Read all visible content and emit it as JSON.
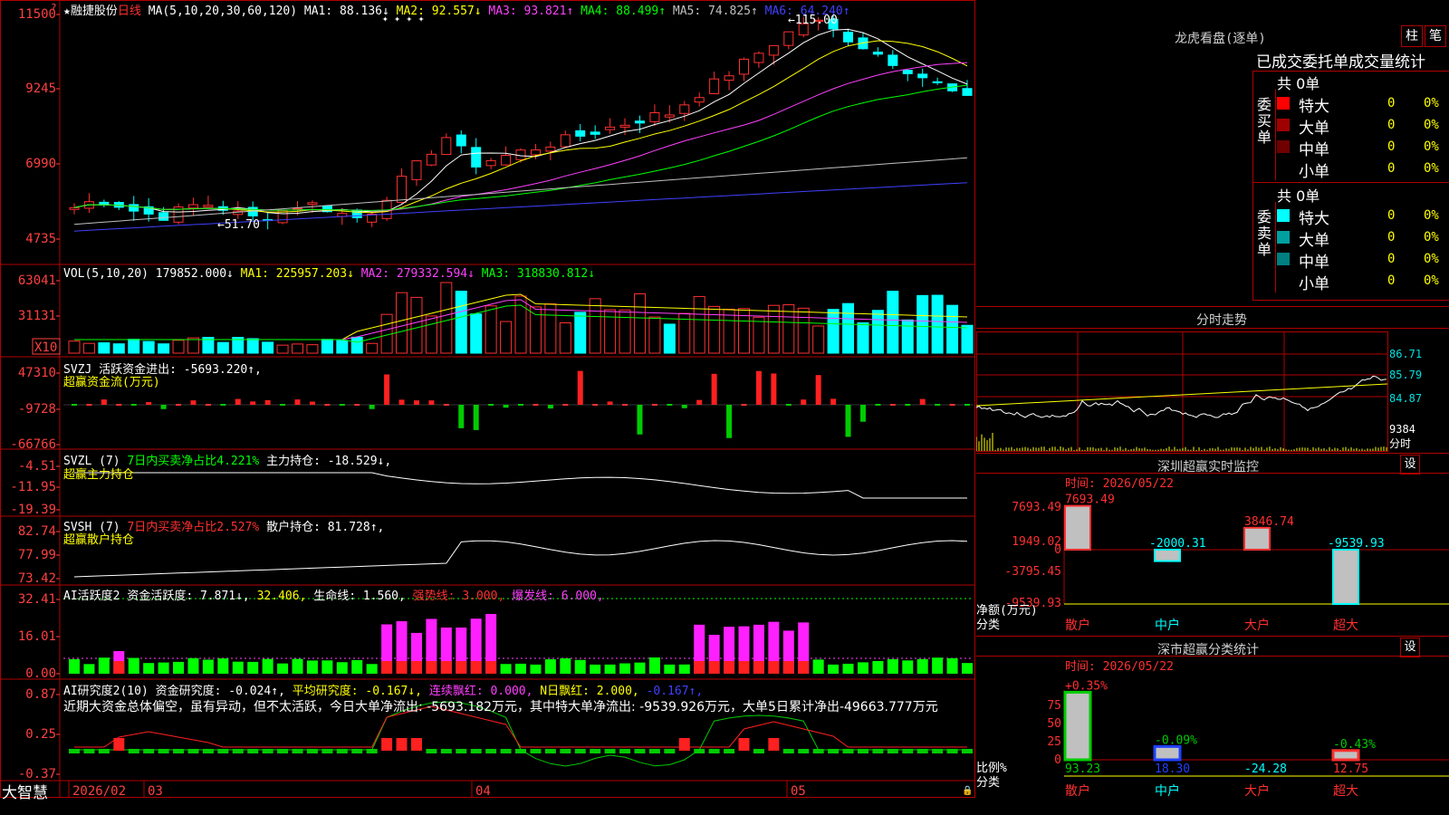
{
  "stock": {
    "name": "融捷股份",
    "period": "日线",
    "star": "★"
  },
  "main": {
    "ma_params": "MA(5,10,20,30,60,120)",
    "ma": [
      {
        "label": "MA1:",
        "value": "88.136↓",
        "color": "#ffffff"
      },
      {
        "label": "MA2:",
        "value": "92.557↓",
        "color": "#ffff00"
      },
      {
        "label": "MA3:",
        "value": "93.821↑",
        "color": "#ff40ff"
      },
      {
        "label": "MA4:",
        "value": "88.499↑",
        "color": "#00ff00"
      },
      {
        "label": "MA5:",
        "value": "74.825↑",
        "color": "#c0c0c0"
      },
      {
        "label": "MA6:",
        "value": "64.240↑",
        "color": "#4040ff"
      }
    ],
    "yticks": [
      "11500",
      "9245",
      "6990",
      "4735"
    ],
    "high_label": "←115.00",
    "low_label": "←51.70",
    "markers": "✦ ✦ ✦ ✦"
  },
  "vol": {
    "params": "VOL(5,10,20)",
    "value": "179852.000↓",
    "ma": [
      {
        "label": "MA1:",
        "value": "225957.203↓",
        "color": "#ffff00"
      },
      {
        "label": "MA2:",
        "value": "279332.594↓",
        "color": "#ff40ff"
      },
      {
        "label": "MA3:",
        "value": "318830.812↓",
        "color": "#00ff00"
      }
    ],
    "yticks": [
      "63041",
      "31131"
    ],
    "unit": "X10"
  },
  "svzj": {
    "name": "SVZJ",
    "text": "活跃资金进出: -5693.220↑,",
    "sub": "超赢资金流(万元)",
    "yticks": [
      "47310",
      "-9728",
      "-66766"
    ]
  },
  "svzl": {
    "name": "SVZL (7)",
    "text1": "7日内买卖净占比4.221%",
    "text2": "主力持仓: -18.529↓,",
    "sub": "超赢主力持仓",
    "yticks": [
      "-4.51",
      "-11.95",
      "-19.39"
    ]
  },
  "svsh": {
    "name": "SVSH (7)",
    "text1": "7日内买卖净占比2.527%",
    "text2": "散户持仓: 81.728↑,",
    "sub": "超赢散户持仓",
    "yticks": [
      "82.74",
      "77.99",
      "73.42"
    ]
  },
  "ai1": {
    "name": "AI活跃度2",
    "t1": "资金活跃度: 7.871↓,",
    "t2": "32.406,",
    "t3": "生命线: 1.560,",
    "t4": "强势线: 3.000,",
    "t5": "爆发线: 6.000,",
    "yticks": [
      "32.41",
      "16.01",
      "0.00"
    ]
  },
  "ai2": {
    "name": "AI研究度2(10)",
    "t1": "资金研究度: -0.024↑,",
    "t2": "平均研究度: -0.167↓,",
    "t3": "连续飘红: 0.000,",
    "t4": "N日飘红: 2.000,",
    "t5": "-0.167↑,",
    "comment": "近期大资金总体偏空，虽有异动，但不太活跃，今日大单净流出: -5693.182万元，其中特大单净流出: -9539.926万元，大单5日累计净出-49663.777万元",
    "yticks": [
      "0.87",
      "0.25",
      "-0.37"
    ]
  },
  "bottom": {
    "brand": "大智慧",
    "dates": [
      "2026/02",
      "03",
      "04",
      "05"
    ]
  },
  "lhb": {
    "title": "龙虎看盘(逐单)",
    "btn1": "柱",
    "btn2": "笔",
    "subtitle": "已成交委托单成交量统计",
    "buy": {
      "side": "委买单",
      "total": "共 0单",
      "rows": [
        {
          "label": "特大",
          "v": "0",
          "p": "0%",
          "color": "#ff0000"
        },
        {
          "label": "大单",
          "v": "0",
          "p": "0%",
          "color": "#a00000"
        },
        {
          "label": "中单",
          "v": "0",
          "p": "0%",
          "color": "#700000"
        },
        {
          "label": "小单",
          "v": "0",
          "p": "0%",
          "color": "#000000"
        }
      ]
    },
    "sell": {
      "side": "委卖单",
      "total": "共 0单",
      "rows": [
        {
          "label": "特大",
          "v": "0",
          "p": "0%",
          "color": "#00ffff"
        },
        {
          "label": "大单",
          "v": "0",
          "p": "0%",
          "color": "#00a0a0"
        },
        {
          "label": "中单",
          "v": "0",
          "p": "0%",
          "color": "#008080"
        },
        {
          "label": "小单",
          "v": "0",
          "p": "0%",
          "color": "#000000"
        }
      ]
    }
  },
  "fs": {
    "title": "分时走势",
    "yticks": [
      "86.71",
      "85.79",
      "84.87"
    ],
    "vol": "9384",
    "vol_label": "分时"
  },
  "sz1": {
    "title": "深圳超赢实时监控",
    "btn": "设",
    "time": "时间: 2026/05/22",
    "yticks": [
      "7693.49",
      "1949.02",
      "0",
      "-3795.45",
      "-9539.93"
    ],
    "ylabel": "净额(万元)",
    "xlabel": "分类",
    "cats": [
      "散户",
      "中户",
      "大户",
      "超大"
    ],
    "labels": [
      "7693.49",
      "-2000.31",
      "3846.74",
      "-9539.93"
    ]
  },
  "sz2": {
    "title": "深市超赢分类统计",
    "btn": "设",
    "time": "时间: 2026/05/22",
    "yticks": [
      "75",
      "50",
      "25",
      "0"
    ],
    "ylabel": "比例%",
    "xlabel": "分类",
    "cats": [
      "散户",
      "中户",
      "大户",
      "超大"
    ],
    "top": [
      "+0.35%",
      "-0.09%",
      "",
      "-0.43%"
    ],
    "bottom": [
      "93.23",
      "18.30",
      "-24.28",
      "12.75"
    ]
  },
  "chart_data": [
    {
      "type": "candlestick",
      "title": "融捷股份 日线",
      "ylim": [
        47.35,
        115.0
      ],
      "high": 115.0,
      "low": 51.7
    },
    {
      "type": "bar",
      "title": "深圳超赢实时监控",
      "categories": [
        "散户",
        "中户",
        "大户",
        "超大"
      ],
      "values": [
        7693.49,
        -2000.31,
        3846.74,
        -9539.93
      ],
      "ylabel": "净额(万元)"
    },
    {
      "type": "bar",
      "title": "深市超赢分类统计",
      "categories": [
        "散户",
        "中户",
        "大户",
        "超大"
      ],
      "values": [
        93.23,
        18.3,
        -24.28,
        12.75
      ],
      "change": [
        "+0.35%",
        "-0.09%",
        "",
        "-0.43%"
      ],
      "ylabel": "比例%"
    }
  ]
}
